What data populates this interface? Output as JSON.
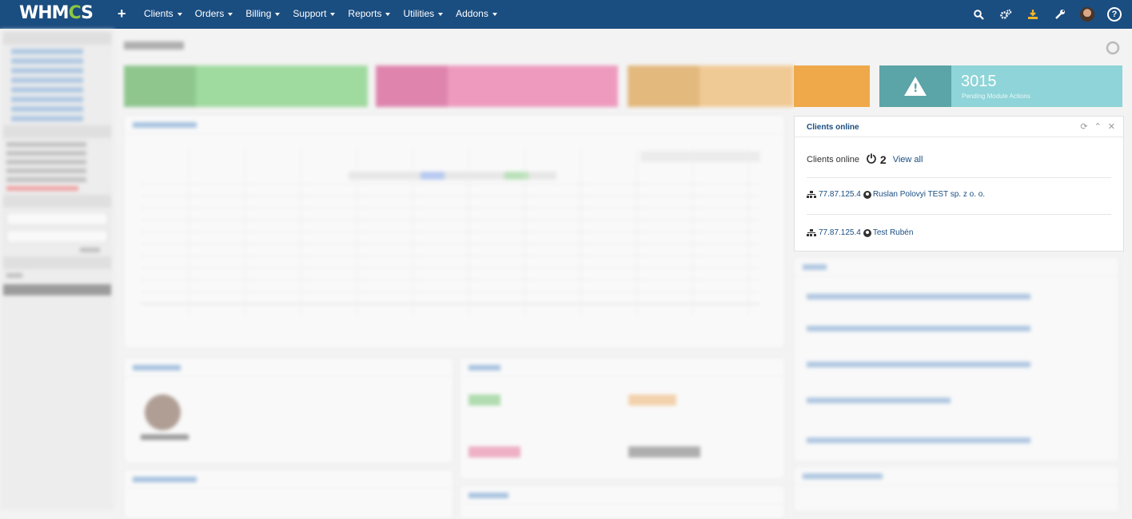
{
  "navbar": {
    "logo": "WHMCS",
    "menu": [
      {
        "label": "Clients"
      },
      {
        "label": "Orders"
      },
      {
        "label": "Billing"
      },
      {
        "label": "Support"
      },
      {
        "label": "Reports"
      },
      {
        "label": "Utilities"
      },
      {
        "label": "Addons"
      }
    ],
    "icons": [
      "search-icon",
      "cogs-icon",
      "download-icon",
      "wrench-icon",
      "avatar",
      "help-icon"
    ]
  },
  "stats": {
    "pending_module_actions": {
      "value": "3015",
      "label": "Pending Module Actions",
      "color": "#8ed4d8"
    }
  },
  "clients_online": {
    "title": "Clients online",
    "summary_label": "Clients online",
    "count": "2",
    "view_all": "View all",
    "clients": [
      {
        "ip": "77.87.125.4",
        "name": "Ruslan Polovyi TEST sp. z o. o."
      },
      {
        "ip": "77.87.125.4",
        "name": "Test Rubén"
      }
    ]
  },
  "colors": {
    "navbar": "#1a4d80",
    "green_tile": "#5cc65a",
    "pink_tile": "#ea5393",
    "orange_tile": "#efa94a",
    "teal_tile": "#8ed4d8"
  }
}
